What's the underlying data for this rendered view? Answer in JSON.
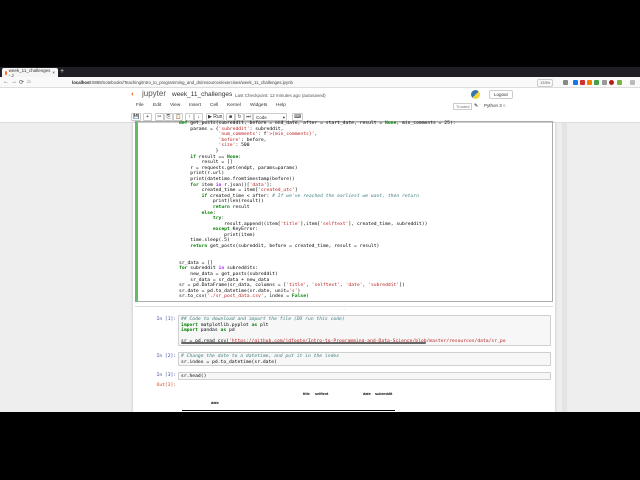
{
  "browser": {
    "tab_title": "week_11_challenges - J",
    "new_tab": "+",
    "url_host": "localhost",
    "url_path": ":8888/notebooks/Teaching/Intro_to_programming_and_ds/resources/exercises/week_11_challenges.ipynb",
    "zoom": "133%",
    "nav": {
      "back": "←",
      "forward": "→",
      "reload": "⟳",
      "home": "⌂"
    }
  },
  "header": {
    "logo_text": "jupyter",
    "notebook_name": "week_11_challenges",
    "checkpoint": "Last Checkpoint: 12 minutes ago",
    "save_status": "(autosaved)",
    "logout": "Logout"
  },
  "menu": [
    "File",
    "Edit",
    "View",
    "Insert",
    "Cell",
    "Kernel",
    "Widgets",
    "Help"
  ],
  "status": {
    "trusted": "Trusted",
    "kernel": "Python 3"
  },
  "toolbar": {
    "run": "▶ Run",
    "cell_type": "Code",
    "buttons": [
      "💾",
      "+",
      "✂",
      "⎘",
      "📋",
      "↑",
      "↓",
      "■",
      "↻",
      "⏭",
      "⌨"
    ]
  },
  "cells": {
    "active_code": [
      "def get_posts(subreddit, before = end_date, after = start_date, result = None, min_comments = 25):",
      "    params = {'subreddit': subreddit,",
      "              'num_comments': f'>{min_comments}',",
      "              'before': before,",
      "              'size': 500",
      "             }",
      "    if result == None:",
      "        result = []",
      "    r = requests.get(endpt, params=params)",
      "    print(r.url)",
      "    print(datetime.fromtimestamp(before))",
      "    for item in r.json()['data']:",
      "        created_time = item['created_utc']",
      "        if created_time < after: # If we've reached the earliest we want, then return",
      "            print(len(result))",
      "            return result",
      "        else:",
      "            try:",
      "                result.append((item['title'],item['selftext'], created_time, subreddit))",
      "            except KeyError:",
      "                print(item)",
      "    time.sleep(.5)",
      "    return get_posts(subreddit, before = created_time, result = result)",
      "",
      "",
      "sr_data = []",
      "for subreddit in subreddits:",
      "    new_data = get_posts(subreddit)",
      "    sr_data = sr_data + new_data",
      "sr = pd.DataFrame(sr_data, columns = ['title', 'selftext', 'date', 'subreddit'])",
      "sr.date = pd.to_datetime(sr.date, unit='s')",
      "sr.to_csv('./sr_post_data.csv', index = False)"
    ],
    "collapse_marker": "...",
    "c1": {
      "prompt": "In [1]:",
      "code": [
        "## Code to download and import the file (DO run this code)",
        "import matplotlib.pyplot as plt",
        "import pandas as pd",
        "",
        "sr = pd.read_csv('https://github.com/jdfoote/Intro-to-Programming-and-Data-Science/blob/master/resources/data/sr_po"
      ]
    },
    "c2": {
      "prompt": "In [2]:",
      "code": [
        "# Change the date to a datetime, and put it in the index",
        "sr.index = pd.to_datetime(sr.date)"
      ]
    },
    "c3": {
      "prompt": "In [3]:",
      "code": [
        "sr.head()"
      ],
      "out_prompt": "Out[3]:",
      "columns": [
        "title",
        "selftext",
        "date",
        "subreddit"
      ],
      "index_name": "date"
    }
  }
}
